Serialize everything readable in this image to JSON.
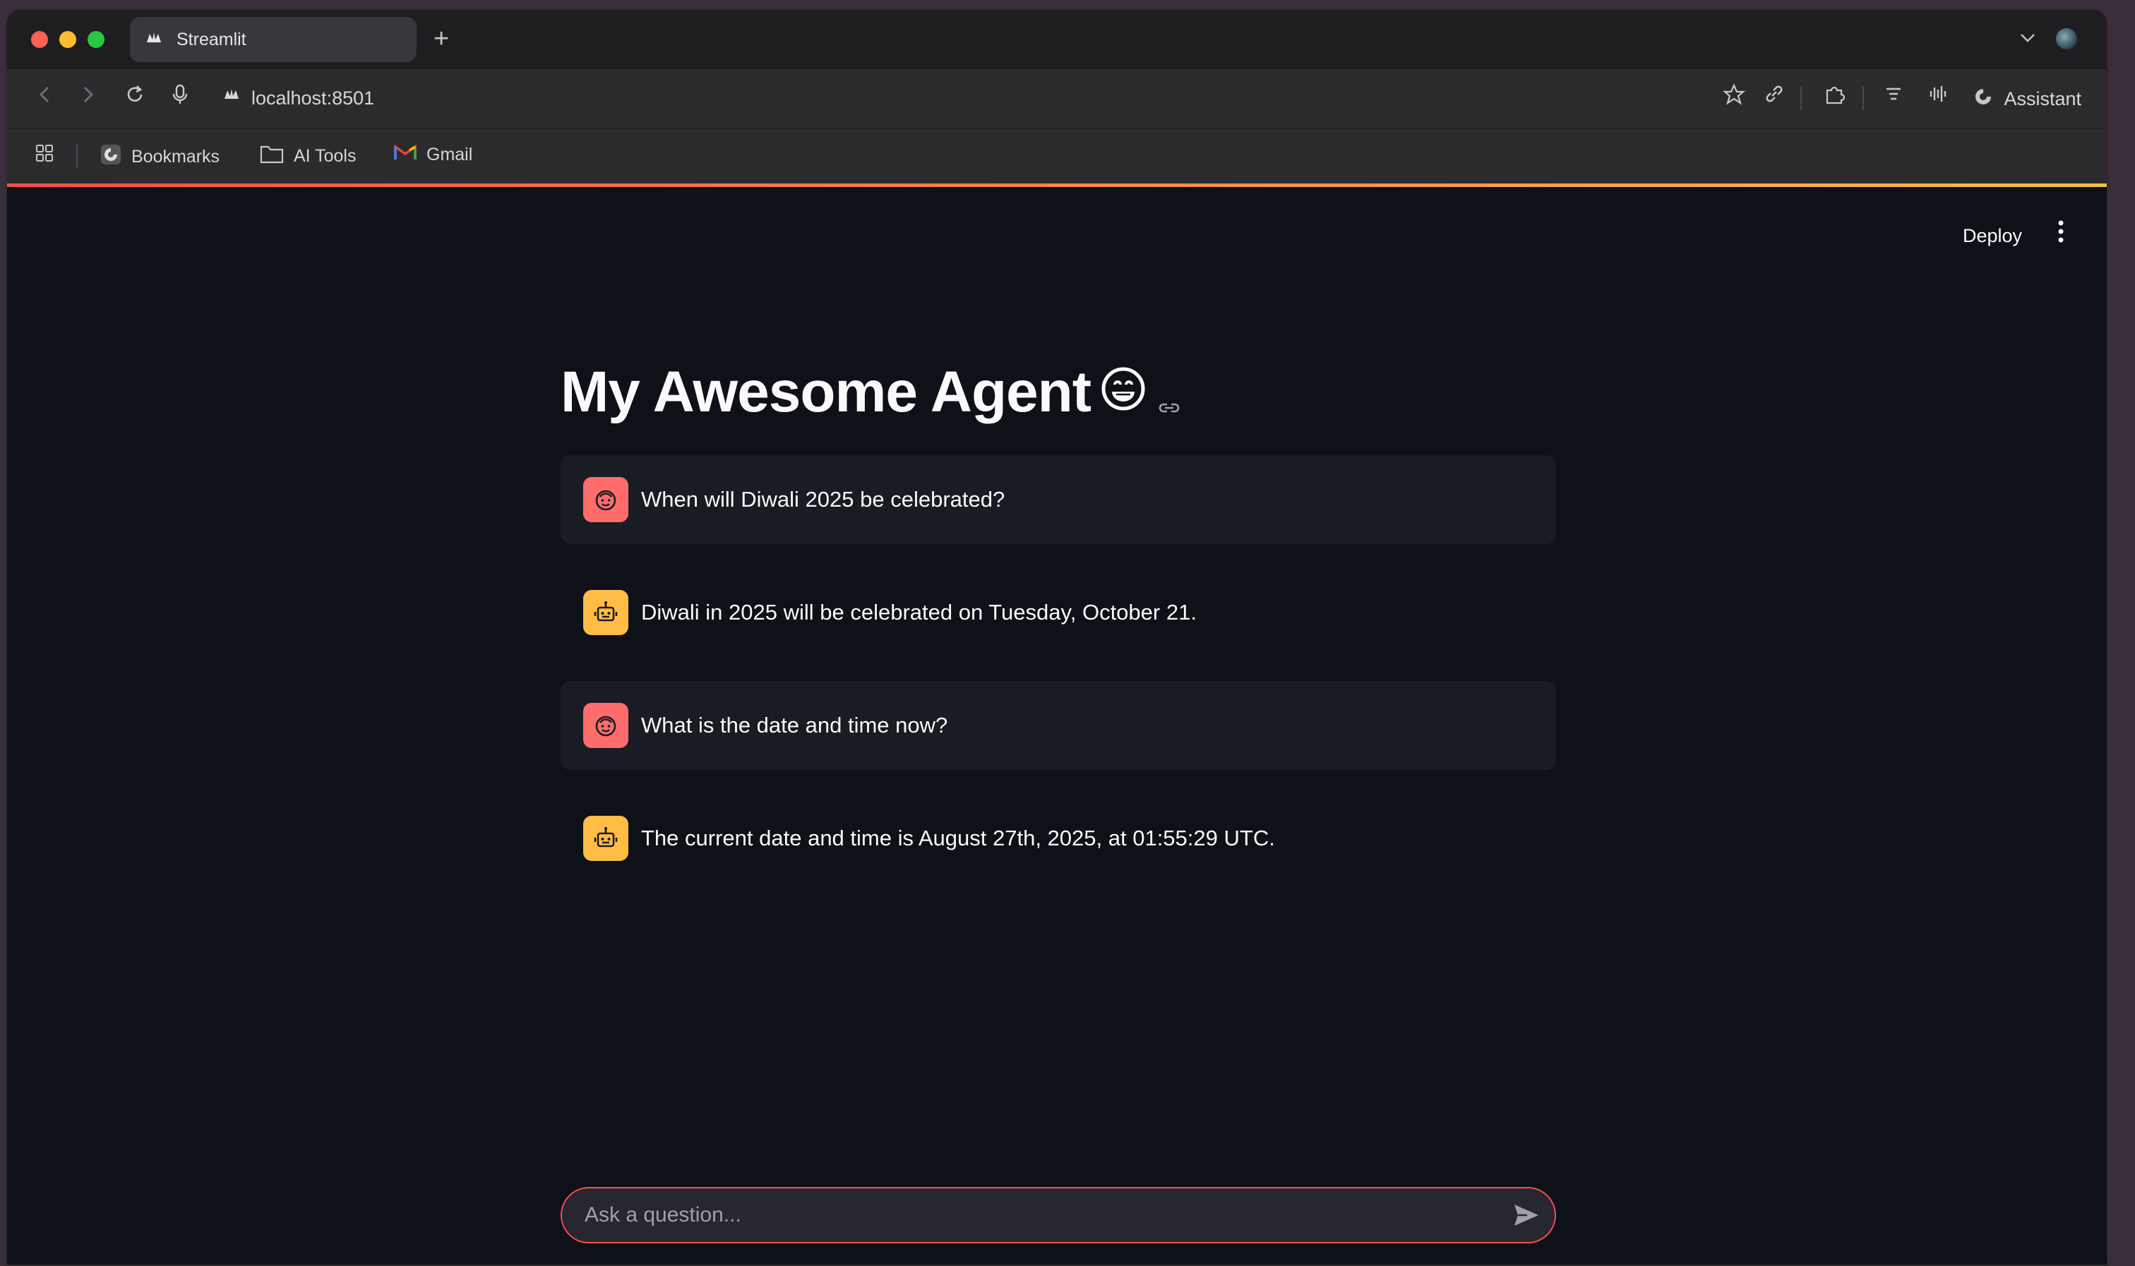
{
  "browser": {
    "tab_title": "Streamlit",
    "new_tab_symbol": "+",
    "url": "localhost:8501",
    "assistant_label": "Assistant",
    "bookmarks": [
      "Bookmarks",
      "AI Tools",
      "Gmail"
    ]
  },
  "app": {
    "deploy_label": "Deploy",
    "title": "My Awesome Agent",
    "messages": [
      {
        "role": "user",
        "text": "When will Diwali 2025 be celebrated?"
      },
      {
        "role": "assistant",
        "text": "Diwali in 2025 will be celebrated on Tuesday, October 21."
      },
      {
        "role": "user",
        "text": "What is the date and time now?"
      },
      {
        "role": "assistant",
        "text": "The current date and time is August 27th, 2025, at 01:55:29 UTC."
      }
    ],
    "input_placeholder": "Ask a question..."
  },
  "colors": {
    "background": "#0e1117",
    "user_avatar": "#ff6c6c",
    "bot_avatar": "#ffbd45",
    "accent": "#ff4b4b"
  },
  "icons": {
    "user": "smiling-face-icon",
    "assistant": "robot-icon",
    "send": "send-icon"
  }
}
